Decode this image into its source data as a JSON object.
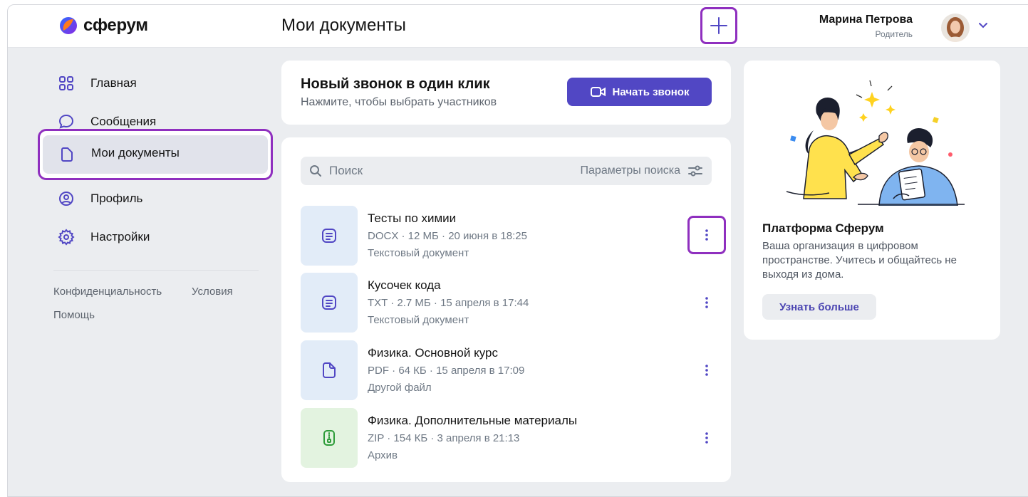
{
  "app": {
    "logo_text": "сферум",
    "page_title": "Мои документы"
  },
  "user": {
    "name": "Марина Петрова",
    "role": "Родитель"
  },
  "sidebar": {
    "items": [
      {
        "label": "Главная",
        "icon": "grid-icon"
      },
      {
        "label": "Сообщения",
        "icon": "chat-icon"
      },
      {
        "label": "Мои документы",
        "icon": "document-icon",
        "active": true
      },
      {
        "label": "Профиль",
        "icon": "profile-icon"
      },
      {
        "label": "Настройки",
        "icon": "settings-icon"
      }
    ],
    "footer": {
      "privacy": "Конфиденциальность",
      "terms": "Условия",
      "help": "Помощь"
    }
  },
  "call": {
    "title": "Новый звонок в один клик",
    "subtitle": "Нажмите, чтобы выбрать участников",
    "button": "Начать звонок"
  },
  "search": {
    "placeholder": "Поиск",
    "params": "Параметры поиска"
  },
  "documents": [
    {
      "name": "Тесты по химии",
      "meta": "DOCX · 12 МБ · 20 июня в 18:25",
      "type": "Текстовый документ",
      "icon": "text-document-icon"
    },
    {
      "name": "Кусочек кода",
      "meta": "TXT · 2.7 МБ · 15 апреля в 17:44",
      "type": "Текстовый документ",
      "icon": "text-document-icon"
    },
    {
      "name": "Физика. Основной курс",
      "meta": "PDF · 64 КБ · 15 апреля в 17:09",
      "type": "Другой файл",
      "icon": "file-icon"
    },
    {
      "name": "Физика. Дополнительные материалы",
      "meta": "ZIP · 154 КБ · 3 апреля в 21:13",
      "type": "Архив",
      "icon": "archive-icon"
    }
  ],
  "promo": {
    "title": "Платформа Сферум",
    "text": "Ваша организация в цифровом пространстве. Учитесь и общайтесь не выходя из дома.",
    "button": "Узнать больше"
  },
  "colors": {
    "accent": "#5147c4",
    "highlight": "#8f2fbf",
    "background": "#ebedf0"
  }
}
